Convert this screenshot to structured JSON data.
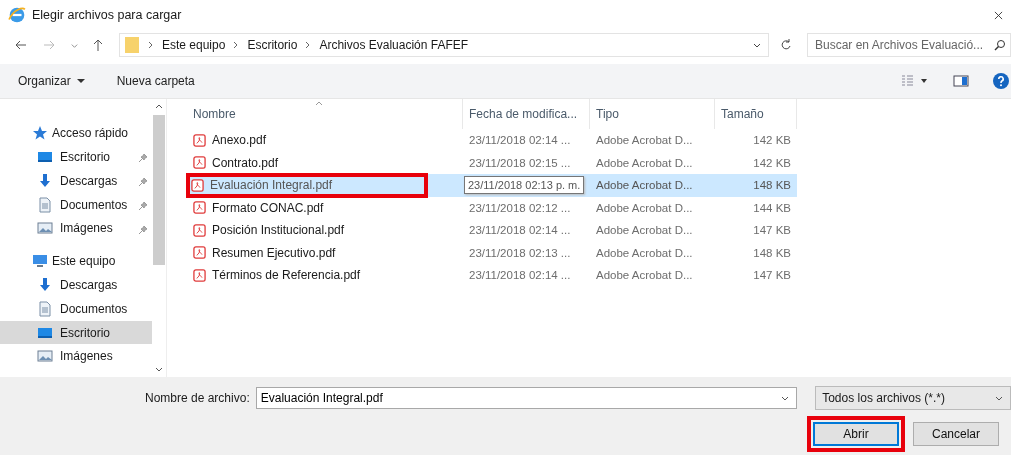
{
  "window": {
    "title": "Elegir archivos para cargar"
  },
  "address": {
    "crumbs": [
      "Este equipo",
      "Escritorio",
      "Archivos Evaluación FAFEF"
    ]
  },
  "search": {
    "placeholder": "Buscar en Archivos Evaluació..."
  },
  "toolbar": {
    "organize": "Organizar",
    "new_folder": "Nueva carpeta"
  },
  "sidebar": {
    "groups": [
      {
        "label": "Acceso rápido",
        "kind": "star",
        "children": [
          {
            "label": "Escritorio",
            "kind": "desktop",
            "pinned": true,
            "selected": false
          },
          {
            "label": "Descargas",
            "kind": "download",
            "pinned": true,
            "selected": false
          },
          {
            "label": "Documentos",
            "kind": "document",
            "pinned": true,
            "selected": false
          },
          {
            "label": "Imágenes",
            "kind": "image",
            "pinned": true,
            "selected": false
          }
        ]
      },
      {
        "label": "Este equipo",
        "kind": "pc",
        "children": [
          {
            "label": "Descargas",
            "kind": "download",
            "pinned": false,
            "selected": false
          },
          {
            "label": "Documentos",
            "kind": "document",
            "pinned": false,
            "selected": false
          },
          {
            "label": "Escritorio",
            "kind": "desktop",
            "pinned": false,
            "selected": true
          },
          {
            "label": "Imágenes",
            "kind": "image",
            "pinned": false,
            "selected": false
          }
        ]
      }
    ]
  },
  "table": {
    "columns": [
      "Nombre",
      "Fecha de modifica...",
      "Tipo",
      "Tamaño"
    ],
    "rows": [
      {
        "name": "Anexo.pdf",
        "date": "23/11/2018 02:14 ...",
        "type": "Adobe Acrobat D...",
        "size": "142 KB",
        "selected": false,
        "highlighted": false,
        "tooltip": false
      },
      {
        "name": "Contrato.pdf",
        "date": "23/11/2018 02:15 ...",
        "type": "Adobe Acrobat D...",
        "size": "142 KB",
        "selected": false,
        "highlighted": false,
        "tooltip": false
      },
      {
        "name": "Evaluación Integral.pdf",
        "date": "23/11/2018 02:13 p. m.",
        "type": "Adobe Acrobat D...",
        "size": "148 KB",
        "selected": true,
        "highlighted": true,
        "tooltip": true
      },
      {
        "name": "Formato CONAC.pdf",
        "date": "23/11/2018 02:12 ...",
        "type": "Adobe Acrobat D...",
        "size": "144 KB",
        "selected": false,
        "highlighted": false,
        "tooltip": false
      },
      {
        "name": "Posición Institucional.pdf",
        "date": "23/11/2018 02:14 ...",
        "type": "Adobe Acrobat D...",
        "size": "147 KB",
        "selected": false,
        "highlighted": false,
        "tooltip": false
      },
      {
        "name": "Resumen Ejecutivo.pdf",
        "date": "23/11/2018 02:13 ...",
        "type": "Adobe Acrobat D...",
        "size": "148 KB",
        "selected": false,
        "highlighted": false,
        "tooltip": false
      },
      {
        "name": "Términos de Referencia.pdf",
        "date": "23/11/2018 02:14 ...",
        "type": "Adobe Acrobat D...",
        "size": "147 KB",
        "selected": false,
        "highlighted": false,
        "tooltip": false
      }
    ]
  },
  "footer": {
    "filename_label": "Nombre de archivo:",
    "filename": "Evaluación Integral.pdf",
    "filter": "Todos los archivos (*.*)",
    "buttons": [
      {
        "label": "Abrir",
        "default": true,
        "highlighted": true
      },
      {
        "label": "Cancelar",
        "default": false,
        "highlighted": false
      }
    ]
  }
}
